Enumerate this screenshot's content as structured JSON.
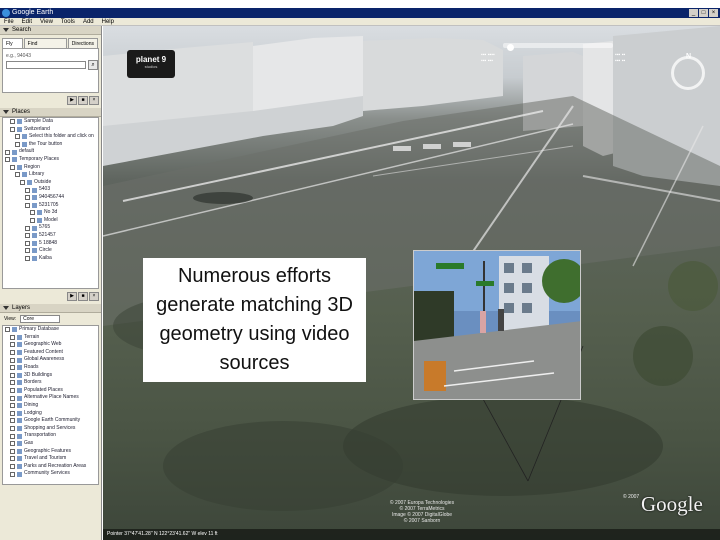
{
  "window": {
    "title": "Google Earth"
  },
  "menu": [
    "File",
    "Edit",
    "View",
    "Tools",
    "Add",
    "Help"
  ],
  "search": {
    "header": "Search",
    "tabs": [
      "Fly To",
      "Find Businesses",
      "Directions"
    ],
    "example": "e.g., 94043"
  },
  "places": {
    "header": "Places",
    "items": [
      "Sample Data",
      "Switzerland",
      "Select this folder and click on",
      "the Tour button",
      "default",
      "Temporary Places",
      "Region",
      "Library",
      "Outside",
      "5403",
      "940456744",
      "5231705",
      "No 3d",
      "Model",
      "5765",
      "521457",
      "5 18848",
      "Circle",
      "Kaiba"
    ]
  },
  "layers": {
    "header": "Layers",
    "view_label": "View:",
    "view_value": "Core",
    "items": [
      "Primary Database",
      "Terrain",
      "Geographic Web",
      "Featured Content",
      "Global Awareness",
      "Roads",
      "3D Buildings",
      "Borders",
      "Populated Places",
      "Alternative Place Names",
      "Dining",
      "Lodging",
      "Google Earth Community",
      "Shopping and Services",
      "Transportation",
      "Gas",
      "Geographic Features",
      "Travel and Tourism",
      "Parks and Recreation Areas",
      "Community Services"
    ]
  },
  "viewport": {
    "logo_line1": "planet 9",
    "logo_line2": "studios",
    "caption": "Numerous efforts generate matching 3D geometry using video sources",
    "copyright_lines": [
      "© 2007 Europa Technologies",
      "© 2007 TerraMetrics",
      "Image © 2007 DigitalGlobe",
      "© 2007 Sanborn"
    ],
    "google_small": "© 2007",
    "google_logo": "Google",
    "status": "Pointer  37°47'41.28\" N  122°23'41.62\" W  elev  11 ft"
  },
  "colors": {
    "titlebar": "#0a246a",
    "panel": "#ece9d8",
    "sky": "#d9dde1"
  }
}
